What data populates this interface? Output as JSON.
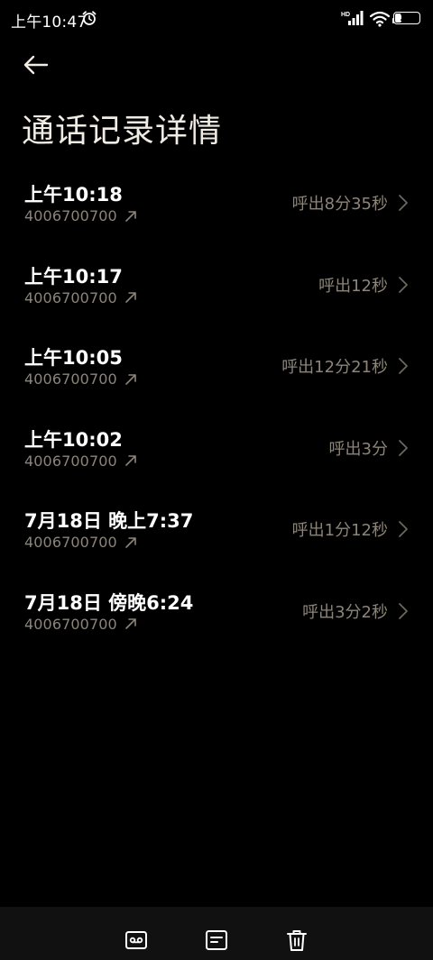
{
  "status_bar": {
    "time": "上午10:47",
    "battery_level": "26",
    "battery_fraction": 0.26,
    "network_label": "HD"
  },
  "header": {
    "title": "通话记录详情"
  },
  "calls": [
    {
      "time": "上午10:18",
      "number": "4006700700",
      "duration": "呼出8分35秒"
    },
    {
      "time": "上午10:17",
      "number": "4006700700",
      "duration": "呼出12秒"
    },
    {
      "time": "上午10:05",
      "number": "4006700700",
      "duration": "呼出12分21秒"
    },
    {
      "time": "上午10:02",
      "number": "4006700700",
      "duration": "呼出3分"
    },
    {
      "time": "7月18日 晚上7:37",
      "number": "4006700700",
      "duration": "呼出1分12秒"
    },
    {
      "time": "7月18日 傍晚6:24",
      "number": "4006700700",
      "duration": "呼出3分2秒"
    }
  ],
  "bottom_bar": {
    "buttons": [
      "voicemail-icon",
      "note-icon",
      "trash-icon"
    ]
  },
  "colors": {
    "background": "#000000",
    "primary_text": "#ffffff",
    "secondary_text": "#8c8478",
    "bottom_bar": "#111111"
  }
}
